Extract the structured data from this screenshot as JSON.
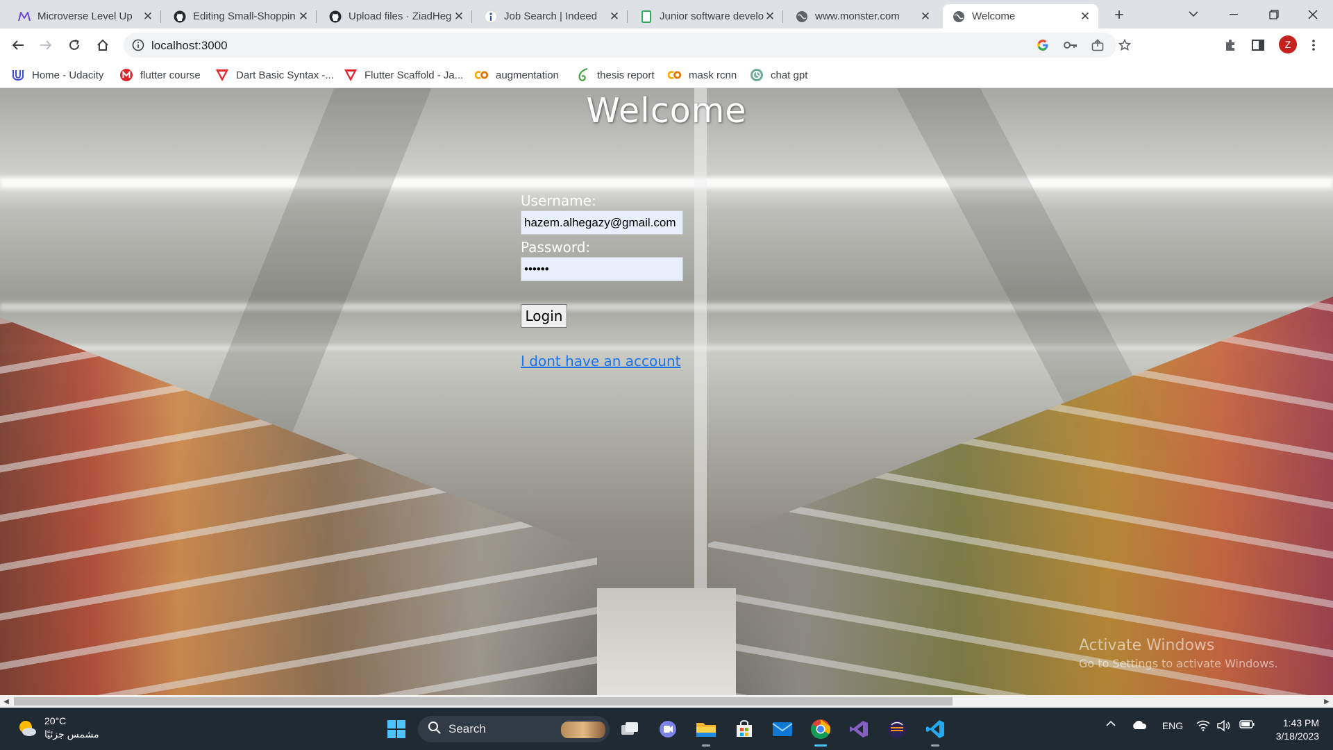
{
  "browser": {
    "tabs": [
      {
        "label": "Microverse Level Up",
        "icon": "microverse-icon"
      },
      {
        "label": "Editing Small-Shoppin",
        "icon": "github-icon"
      },
      {
        "label": "Upload files · ZiadHeg",
        "icon": "github-icon"
      },
      {
        "label": "Job Search | Indeed",
        "icon": "indeed-icon"
      },
      {
        "label": "Junior software develo",
        "icon": "document-icon"
      },
      {
        "label": "www.monster.com",
        "icon": "globe-icon"
      },
      {
        "label": "Welcome",
        "icon": "globe-icon",
        "active": true
      }
    ],
    "url": "localhost:3000",
    "profile_initial": "Z",
    "bookmarks": [
      {
        "label": "Home - Udacity",
        "icon": "udacity-icon"
      },
      {
        "label": "flutter course",
        "icon": "mega-icon"
      },
      {
        "label": "Dart Basic Syntax -...",
        "icon": "vivaldi-icon"
      },
      {
        "label": "Flutter Scaffold - Ja...",
        "icon": "vivaldi-icon"
      },
      {
        "label": "augmentation",
        "icon": "colab-icon"
      },
      {
        "label": "thesis report",
        "icon": "overleaf-icon"
      },
      {
        "label": "mask rcnn",
        "icon": "colab-icon"
      },
      {
        "label": "chat gpt",
        "icon": "openai-icon"
      }
    ]
  },
  "page": {
    "heading": "Welcome",
    "username_label": "Username:",
    "username_value": "hazem.alhegazy@gmail.com",
    "password_label": "Password:",
    "password_value": "abcdef",
    "login_label": "Login",
    "no_account_link": "I dont have an account"
  },
  "watermark": {
    "line1": "Activate Windows",
    "line2": "Go to Settings to activate Windows."
  },
  "taskbar": {
    "temperature": "20°C",
    "weather_text": "مشمس جزئيًا",
    "search_label": "Search",
    "apps": [
      "windows-start-icon",
      "task-view-icon",
      "teams-icon",
      "file-explorer-icon",
      "microsoft-store-icon",
      "mail-icon",
      "chrome-icon",
      "visual-studio-icon",
      "eclipse-icon",
      "vscode-icon"
    ],
    "language": "ENG",
    "time": "1:43 PM",
    "date": "3/18/2023"
  },
  "colors": {
    "link": "#1a73e8",
    "input_autofill_bg": "#e8f0fe",
    "taskbar_bg": "#202a33",
    "tabstrip_bg": "#dee1e6"
  }
}
